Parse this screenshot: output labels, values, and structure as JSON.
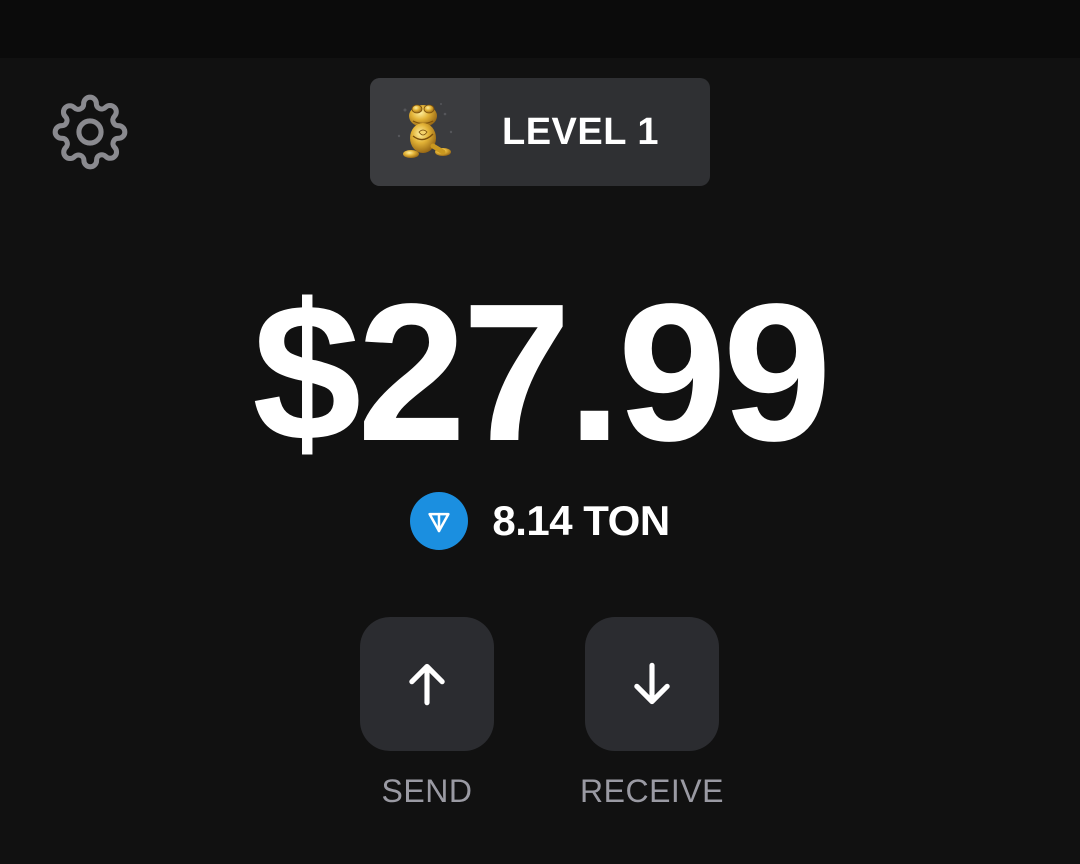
{
  "header": {
    "level_label": "LEVEL 1",
    "settings_icon": "gear-icon",
    "level_avatar_icon": "golden-frog-avatar"
  },
  "wallet": {
    "balance_usd": "$27.99",
    "ton_amount": "8.14 TON",
    "ton_icon": "ton-logo-icon",
    "ton_color": "#1b8fe0"
  },
  "actions": {
    "send_label": "SEND",
    "send_icon": "arrow-up-icon",
    "receive_label": "RECEIVE",
    "receive_icon": "arrow-down-icon"
  },
  "colors": {
    "background": "#111111",
    "button_bg": "#2b2c30",
    "badge_bg": "#2f3033",
    "muted_text": "#9a9aa3"
  }
}
